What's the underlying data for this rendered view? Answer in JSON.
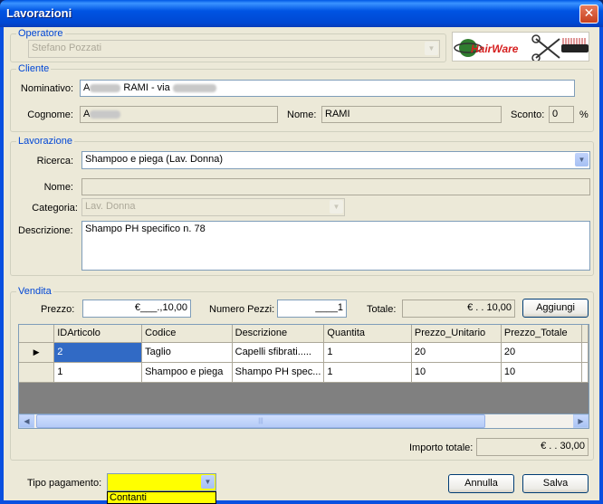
{
  "window": {
    "title": "Lavorazioni"
  },
  "operatore": {
    "legend": "Operatore",
    "value": "Stefano Pozzati"
  },
  "logo": {
    "text": "HairWare"
  },
  "cliente": {
    "legend": "Cliente",
    "nominativo_label": "Nominativo:",
    "nominativo_prefix": "A",
    "nominativo_mid": " RAMI - via ",
    "cognome_label": "Cognome:",
    "cognome_value": "A",
    "nome_label": "Nome:",
    "nome_value": "RAMI",
    "sconto_label": "Sconto:",
    "sconto_value": "0",
    "sconto_unit": "%"
  },
  "lavorazione": {
    "legend": "Lavorazione",
    "ricerca_label": "Ricerca:",
    "ricerca_value": "Shampoo e piega (Lav. Donna)",
    "nome_label": "Nome:",
    "nome_value": "",
    "categoria_label": "Categoria:",
    "categoria_value": "Lav. Donna",
    "descrizione_label": "Descrizione:",
    "descrizione_value": "Shampo PH specifico n. 78"
  },
  "vendita": {
    "legend": "Vendita",
    "prezzo_label": "Prezzo:",
    "prezzo_value": "€___.,10,00",
    "pezzi_label": "Numero Pezzi:",
    "pezzi_value": "____1",
    "totale_label": "Totale:",
    "totale_value": "€ .  . 10,00",
    "aggiungi_label": "Aggiungi",
    "grid": {
      "columns": [
        "IDArticolo",
        "Codice",
        "Descrizione",
        "Quantita",
        "Prezzo_Unitario",
        "Prezzo_Totale"
      ],
      "rows": [
        [
          "2",
          "Taglio",
          "Capelli sfibrati.....",
          "1",
          "20",
          "20"
        ],
        [
          "1",
          "Shampoo e piega",
          "Shampo PH spec...",
          "1",
          "10",
          "10"
        ]
      ]
    },
    "importo_label": "Importo totale:",
    "importo_value": "€ .  . 30,00"
  },
  "footer": {
    "tipo_label": "Tipo pagamento:",
    "tipo_value": "",
    "dropdown_option": "Contanti",
    "annulla_label": "Annulla",
    "salva_label": "Salva"
  },
  "colors": {
    "title_bar": "#0054e3",
    "legend_text": "#0046d5",
    "selected_cell": "#316ac5",
    "payment_highlight": "#ffff00"
  }
}
